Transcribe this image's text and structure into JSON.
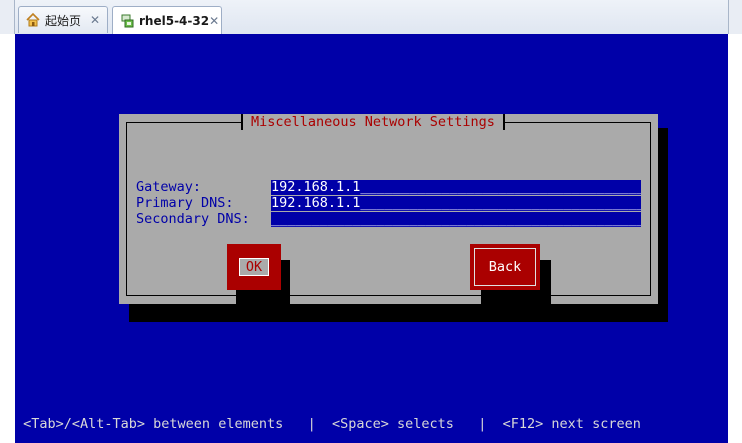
{
  "tabs": [
    {
      "label": "起始页",
      "icon": "home-icon",
      "active": false
    },
    {
      "label": "rhel5-4-32",
      "icon": "vm-icon",
      "active": true
    }
  ],
  "tab_close_glyph": "✕",
  "dialog": {
    "title": "Miscellaneous Network Settings",
    "fields": [
      {
        "label": "Gateway:",
        "value": "192.168.1.1",
        "fill": "_____________________________________"
      },
      {
        "label": "Primary DNS:",
        "value": "192.168.1.1",
        "fill": "_____________________________________"
      },
      {
        "label": "Secondary DNS:",
        "value": "",
        "fill": "________________________________________________"
      }
    ],
    "ok_label": "OK",
    "back_label": "Back"
  },
  "helpline": " <Tab>/<Alt-Tab> between elements   |  <Space> selects   |  <F12> next screen",
  "colors": {
    "console_bg": "#0000a8",
    "dialog_bg": "#aaaaaa",
    "accent_red": "#aa0000",
    "input_bg": "#0000a8"
  }
}
